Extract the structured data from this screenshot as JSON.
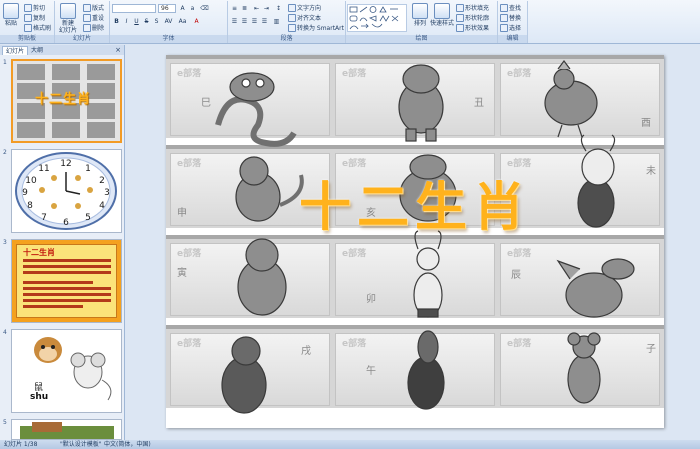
{
  "ribbon": {
    "clipboard": {
      "label": "剪贴板",
      "paste": "粘贴",
      "cut": "剪切",
      "copy": "复制",
      "format_painter": "格式刷"
    },
    "slides": {
      "label": "幻灯片",
      "new_slide": "新建\n幻灯片",
      "layout": "版式",
      "reset": "重设",
      "delete": "删除"
    },
    "font": {
      "label": "字体",
      "size": "96"
    },
    "paragraph": {
      "label": "段落",
      "text_direction": "文字方向",
      "align_text": "对齐文本",
      "smartart": "转换为 SmartArt"
    },
    "drawing": {
      "label": "绘图",
      "arrange": "排列",
      "quick_styles": "快速样式",
      "shape_fill": "形状填充",
      "shape_outline": "形状轮廓",
      "shape_effects": "形状效果"
    },
    "editing": {
      "label": "编辑",
      "find": "查找",
      "replace": "替换",
      "select": "选择"
    }
  },
  "panel": {
    "tabs": [
      "幻灯片",
      "大纲"
    ],
    "close": "×",
    "thumbs": [
      {
        "num": "1"
      },
      {
        "num": "2"
      },
      {
        "num": "3",
        "title": "十二生肖"
      },
      {
        "num": "4",
        "word": "鼠",
        "pinyin": "shu"
      },
      {
        "num": "5"
      }
    ]
  },
  "slide": {
    "title": "十二生肖",
    "watermark": "e部落",
    "zodiac_chars": [
      "巳",
      "丑",
      "酉",
      "未",
      "申",
      "亥",
      "寅",
      "卯",
      "辰",
      "戌",
      "午",
      "子"
    ]
  },
  "status": {
    "slide_info": "幻灯片 1/38",
    "theme": "\"默认设计模板\"",
    "language": "中文(简体，中国)"
  }
}
